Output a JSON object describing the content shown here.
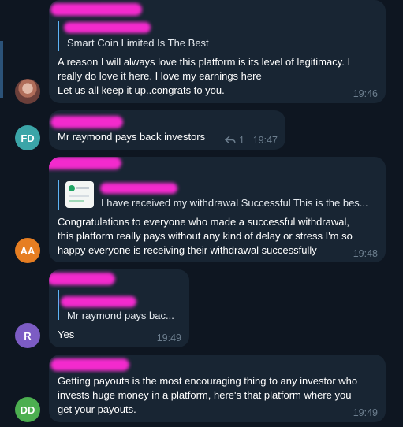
{
  "messages": [
    {
      "avatar": "",
      "reply_text": "Smart Coin Limited Is The Best",
      "lines": [
        "A reason I will always love this platform is its level of legitimacy. I",
        "really do love it here. I love my earnings here",
        "Let us all keep it up..congrats to you."
      ],
      "time": "19:46"
    },
    {
      "avatar": "FD",
      "avatar_color": "#3ba5a8",
      "lines": [
        "Mr raymond pays back investors"
      ],
      "reply_count": "1",
      "time": "19:47"
    },
    {
      "avatar": "AA",
      "avatar_color": "#e67e22",
      "reply_text": "I have received my withdrawal Successful  This is the bes...",
      "lines": [
        "Congratulations to everyone who made a successful withdrawal,",
        "this platform really pays without any kind of delay or stress I'm so",
        "happy everyone is receiving their withdrawal successfully"
      ],
      "time": "19:48"
    },
    {
      "avatar": "R",
      "avatar_color": "#7c5cc4",
      "reply_text": "Mr raymond pays bac...",
      "lines": [
        "Yes"
      ],
      "time": "19:49"
    },
    {
      "avatar": "DD",
      "avatar_color": "#4caf50",
      "lines": [
        "Getting payouts is the most encouraging thing to any investor who",
        "invests huge money in a platform, here's that platform where you",
        "get your payouts."
      ],
      "time": "19:49"
    }
  ]
}
